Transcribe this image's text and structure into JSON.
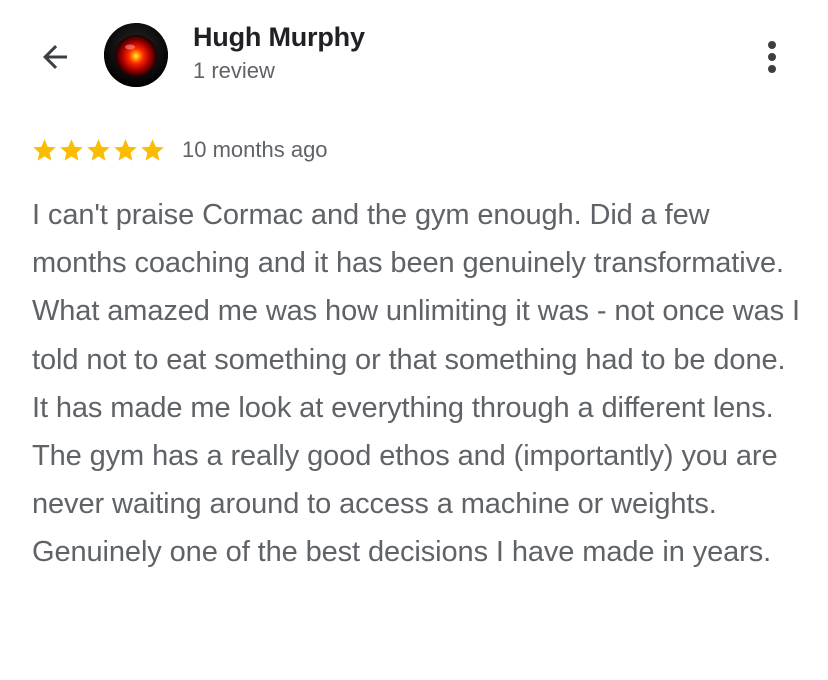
{
  "header": {
    "back_icon": "arrow-back-icon",
    "avatar_icon": "red-eye-avatar",
    "reviewer_name": "Hugh Murphy",
    "review_count": "1 review",
    "more_icon": "more-vert-icon"
  },
  "review": {
    "rating": 5,
    "rating_max": 5,
    "star_color": "#fbbc04",
    "date": "10 months ago",
    "text": "I can't praise Cormac and the gym enough. Did a few months coaching and it has been genuinely transformative. What amazed me was how unlimiting it was - not once was I told not to eat something or that something had to be done. It has made me look at everything through a different lens. The gym has a really good ethos and (importantly) you are never waiting around to access a machine or weights. Genuinely one of the best decisions I have made in years."
  }
}
